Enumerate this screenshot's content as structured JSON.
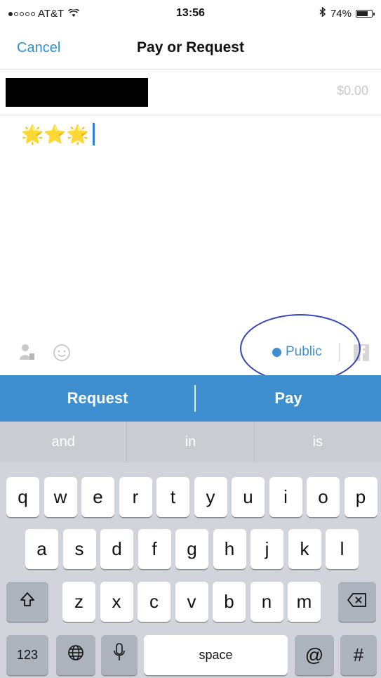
{
  "status_bar": {
    "carrier": "AT&T",
    "time": "13:56",
    "battery": "74%",
    "signal_bars": 1
  },
  "nav": {
    "cancel_label": "Cancel",
    "title": "Pay or Request"
  },
  "form": {
    "amount_placeholder": "$0.00",
    "note_text": "🌟⭐🌟"
  },
  "toolbar": {
    "privacy_label": "Public"
  },
  "actions": {
    "request_label": "Request",
    "pay_label": "Pay"
  },
  "keyboard": {
    "suggestions": [
      "and",
      "in",
      "is"
    ],
    "row1": [
      "q",
      "w",
      "e",
      "r",
      "t",
      "y",
      "u",
      "i",
      "o",
      "p"
    ],
    "row2": [
      "a",
      "s",
      "d",
      "f",
      "g",
      "h",
      "j",
      "k",
      "l"
    ],
    "row3": [
      "z",
      "x",
      "c",
      "v",
      "b",
      "n",
      "m"
    ],
    "numbers_label": "123",
    "space_label": "space",
    "at_label": "@",
    "hash_label": "#"
  },
  "colors": {
    "accent": "#3d8fd0",
    "annotation_oval": "#3343b8",
    "link": "#2f8fd6"
  }
}
